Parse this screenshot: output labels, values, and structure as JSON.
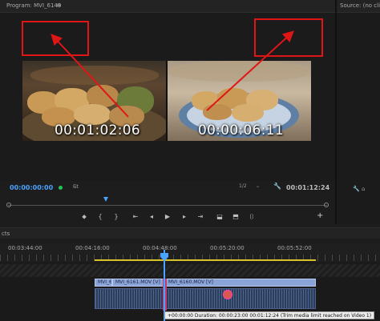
{
  "program_monitor": {
    "title": "Program: MVI_6149",
    "menu_icon": "hamburger-menu-icon",
    "timecode_left": "00:01:02:06",
    "timecode_right": "00:00:06:11"
  },
  "source_monitor": {
    "title": "Source: (no clips)"
  },
  "controls": {
    "current_timecode": "00:00:00:00",
    "fit_label": "Fit",
    "resolution_label": "1/2",
    "duration_timecode": "00:01:12:24",
    "transport_icons": [
      "marker-icon",
      "in-point-icon",
      "out-point-icon",
      "go-to-in-icon",
      "step-back-icon",
      "play-icon",
      "step-forward-icon",
      "go-to-out-icon",
      "lift-icon",
      "extract-icon",
      "export-frame-icon"
    ],
    "transport_glyphs": [
      "⬥",
      "{",
      "}",
      "⇤",
      "◂",
      "▶",
      "▸",
      "⇥",
      "⬓",
      "⬒",
      "⌷"
    ],
    "add_label": "+"
  },
  "timeline": {
    "tab_label": "cts",
    "ruler_labels": [
      "00:03:44:00",
      "00:04:16:00",
      "00:04:48:00",
      "00:05:20:00",
      "00:05:52:00"
    ],
    "clip_video_1": "MVI_6",
    "clip_video_2": "MVI_6161.MOV [V]",
    "clip_video_3": "MVI_6160.MOV [V]",
    "tooltip": "+00:00:00 Duration: 00:00:23:00 00:01:12:24 (Trim media limit reached on Video 1)"
  },
  "annotation_color": "#e01515",
  "accent_color": "#4aa3ff"
}
